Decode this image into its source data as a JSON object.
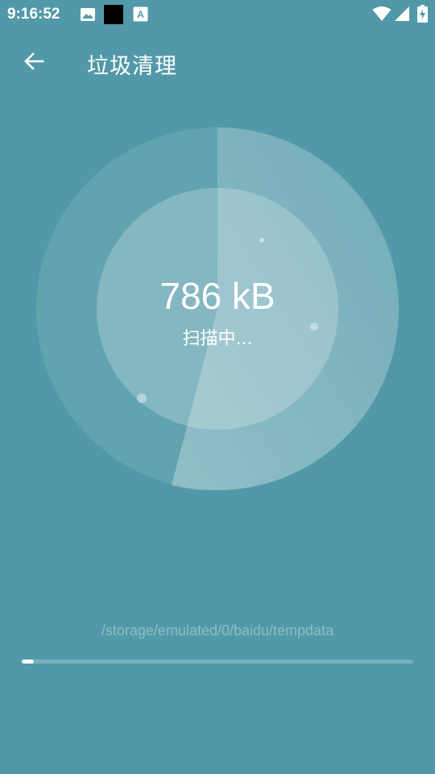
{
  "status_bar": {
    "time": "9:16:52",
    "left_icons": [
      "image-icon",
      "black-square-icon",
      "font-download-icon"
    ],
    "right_icons": [
      "wifi-icon",
      "cellular-signal-icon",
      "battery-charging-icon"
    ]
  },
  "app_bar": {
    "back_icon": "arrow-left-icon",
    "title": "垃圾清理"
  },
  "scanner": {
    "size_text": "786 kB",
    "status_text": "扫描中...",
    "current_path": "/storage/emulated/0/baidu/tempdata",
    "progress": 0.03
  },
  "colors": {
    "background": "#5199a8",
    "accent": "#ffffff"
  }
}
